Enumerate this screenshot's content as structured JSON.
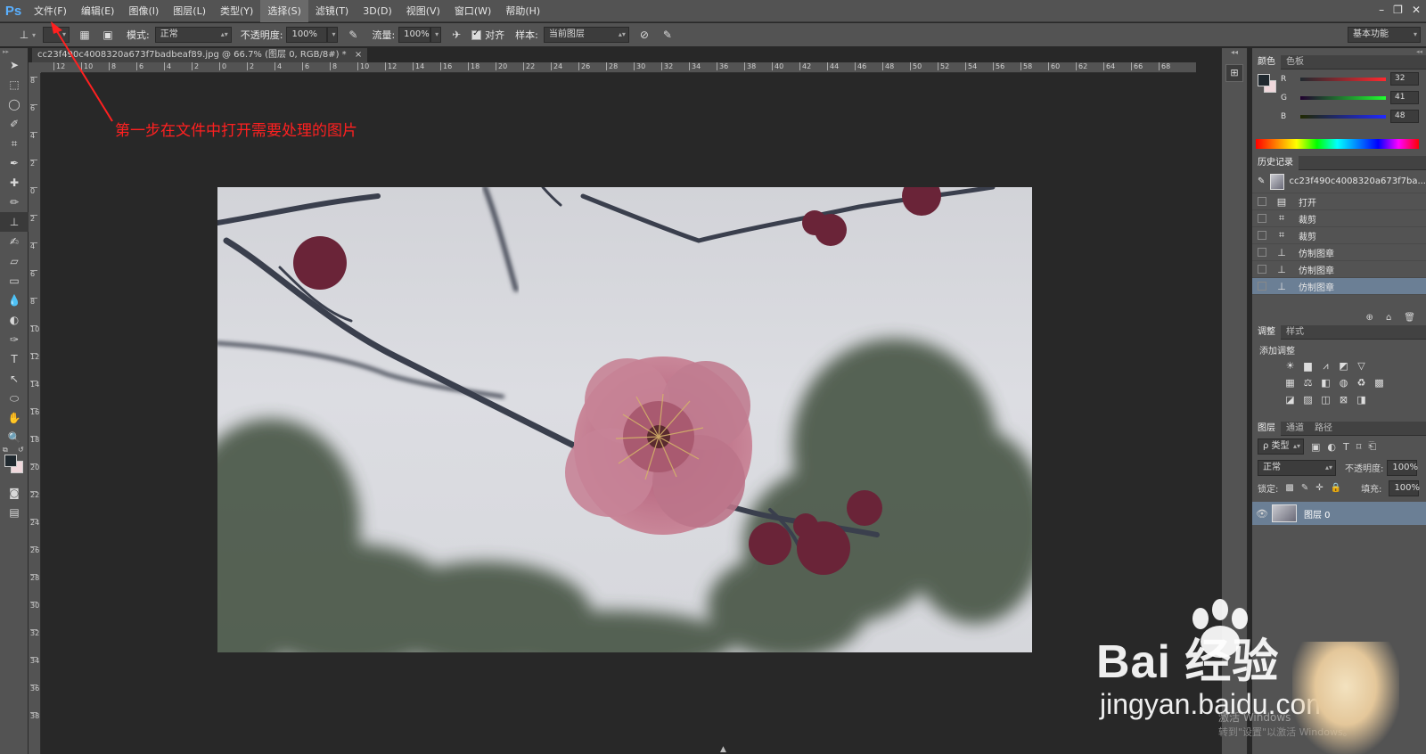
{
  "menubar": {
    "logo": "Ps",
    "items": [
      "文件(F)",
      "编辑(E)",
      "图像(I)",
      "图层(L)",
      "类型(Y)",
      "选择(S)",
      "滤镜(T)",
      "3D(D)",
      "视图(V)",
      "窗口(W)",
      "帮助(H)"
    ],
    "window_controls": [
      "–",
      "❐",
      "✕"
    ]
  },
  "options": {
    "mode_label": "模式:",
    "mode_value": "正常",
    "opacity_label": "不透明度:",
    "opacity_value": "100%",
    "flow_label": "流量:",
    "flow_value": "100%",
    "align_label": "对齐",
    "sample_label": "样本:",
    "sample_value": "当前图层",
    "workspace": "基本功能"
  },
  "document": {
    "tab_title": "cc23f490c4008320a673f7badbeaf89.jpg @ 66.7% (图层 0, RGB/8#) *",
    "tab_close": "×",
    "ruler_top": [
      "12",
      "10",
      "8",
      "6",
      "4",
      "2",
      "0",
      "2",
      "4",
      "6",
      "8",
      "10",
      "12",
      "14",
      "16",
      "18",
      "20",
      "22",
      "24",
      "26",
      "28",
      "30",
      "32",
      "34",
      "36",
      "38",
      "40",
      "42",
      "44",
      "46",
      "48",
      "50",
      "52",
      "54",
      "56",
      "58",
      "60",
      "62",
      "64",
      "66",
      "68"
    ],
    "ruler_left": [
      "8",
      "6",
      "4",
      "2",
      "0",
      "2",
      "4",
      "6",
      "8",
      "10",
      "12",
      "14",
      "16",
      "18",
      "20",
      "22",
      "24",
      "26",
      "28",
      "30",
      "32",
      "34",
      "36",
      "38"
    ]
  },
  "annotation": "第一步在文件中打开需要处理的图片",
  "color_panel": {
    "tabs": [
      "颜色",
      "色板"
    ],
    "r_label": "R",
    "g_label": "G",
    "b_label": "B",
    "r": "32",
    "g": "41",
    "b": "48",
    "fg_color": "#20292f",
    "bg_color": "#f0d8dc"
  },
  "history_panel": {
    "tab": "历史记录",
    "snapshot": "cc23f490c4008320a673f7ba...",
    "items": [
      "打开",
      "裁剪",
      "裁剪",
      "仿制图章",
      "仿制图章",
      "仿制图章"
    ]
  },
  "adjust_panel": {
    "tabs": [
      "调整",
      "样式"
    ],
    "add_label": "添加调整"
  },
  "layers_panel": {
    "tabs": [
      "图层",
      "通道",
      "路径"
    ],
    "filter_kind": "ρ 类型",
    "blend_mode": "正常",
    "opacity_label": "不透明度:",
    "opacity_value": "100%",
    "lock_label": "锁定:",
    "fill_label": "填充:",
    "fill_value": "100%",
    "layer_name": "图层 0"
  },
  "watermark": {
    "main": "Bai 经验",
    "sub": "jingyan.baidu.com",
    "win_activate": "激活 Windows",
    "win_hint": "转到\"设置\"以激活 Windows。"
  }
}
